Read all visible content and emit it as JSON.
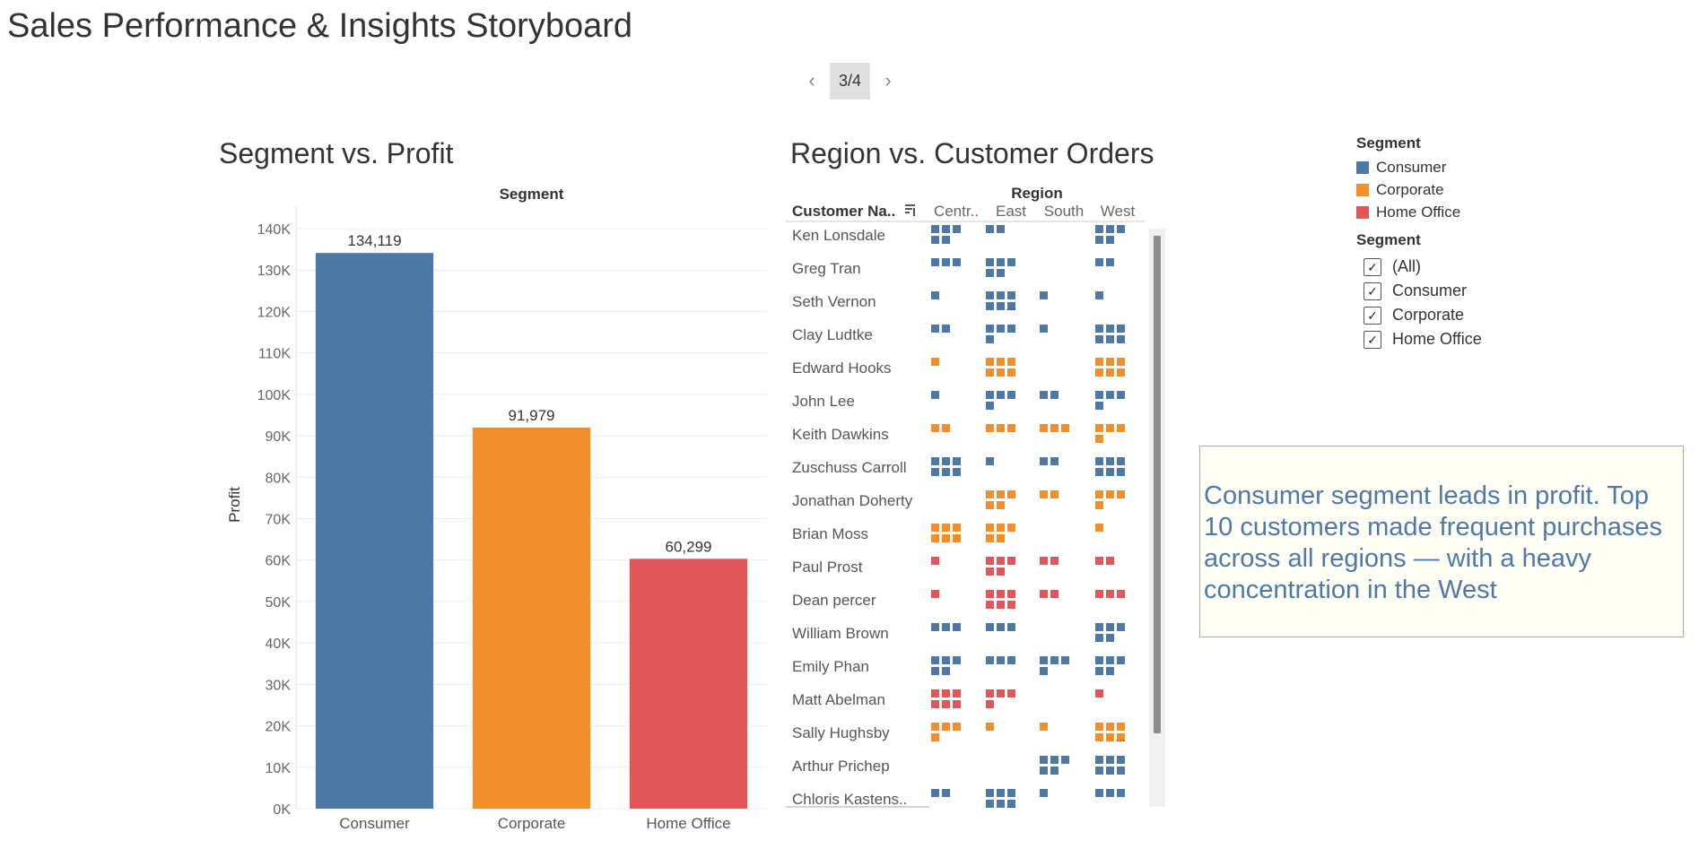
{
  "story": {
    "title": "Sales Performance & Insights Storyboard",
    "page_indicator": "3/4",
    "prev_icon": "‹",
    "next_icon": "›"
  },
  "colors": {
    "Consumer": "#4e79a7",
    "Corporate": "#f28e2b",
    "Home Office": "#e15759"
  },
  "chart_data": [
    {
      "type": "bar",
      "title": "Segment vs. Profit",
      "column_header": "Segment",
      "xlabel": "",
      "ylabel": "Profit",
      "categories": [
        "Consumer",
        "Corporate",
        "Home Office"
      ],
      "values": [
        134119,
        91979,
        60299
      ],
      "value_labels": [
        "134,119",
        "91,979",
        "60,299"
      ],
      "ylim": [
        0,
        140000
      ],
      "yticks": [
        0,
        10000,
        20000,
        30000,
        40000,
        50000,
        60000,
        70000,
        80000,
        90000,
        100000,
        110000,
        120000,
        130000,
        140000
      ],
      "ytick_labels": [
        "0K",
        "10K",
        "20K",
        "30K",
        "40K",
        "50K",
        "60K",
        "70K",
        "80K",
        "90K",
        "100K",
        "110K",
        "120K",
        "130K",
        "140K"
      ],
      "grid": true
    },
    {
      "type": "heatmap",
      "title": "Region vs. Customer Orders",
      "column_header": "Region",
      "row_header": "Customer Na..",
      "sort_icon": "sort-descending-icon",
      "columns": [
        "Centr..",
        "East",
        "South",
        "West"
      ],
      "rows": [
        {
          "name": "Ken Lonsdale",
          "segment": "Consumer",
          "orders": [
            5,
            2,
            0,
            5
          ]
        },
        {
          "name": "Greg Tran",
          "segment": "Consumer",
          "orders": [
            3,
            5,
            0,
            2
          ]
        },
        {
          "name": "Seth Vernon",
          "segment": "Consumer",
          "orders": [
            1,
            7,
            1,
            1
          ]
        },
        {
          "name": "Clay Ludtke",
          "segment": "Consumer",
          "orders": [
            2,
            4,
            1,
            6
          ]
        },
        {
          "name": "Edward Hooks",
          "segment": "Corporate",
          "orders": [
            1,
            6,
            0,
            6
          ]
        },
        {
          "name": "John Lee",
          "segment": "Consumer",
          "orders": [
            1,
            4,
            2,
            4
          ]
        },
        {
          "name": "Keith Dawkins",
          "segment": "Corporate",
          "orders": [
            2,
            3,
            3,
            4
          ]
        },
        {
          "name": "Zuschuss Carroll",
          "segment": "Consumer",
          "orders": [
            6,
            1,
            2,
            6
          ]
        },
        {
          "name": "Jonathan Doherty",
          "segment": "Corporate",
          "orders": [
            0,
            5,
            2,
            4
          ]
        },
        {
          "name": "Brian Moss",
          "segment": "Corporate",
          "orders": [
            6,
            5,
            0,
            1
          ]
        },
        {
          "name": "Paul Prost",
          "segment": "Home Office",
          "orders": [
            1,
            5,
            2,
            2
          ]
        },
        {
          "name": "Dean percer",
          "segment": "Home Office",
          "orders": [
            1,
            6,
            2,
            3
          ]
        },
        {
          "name": "William Brown",
          "segment": "Consumer",
          "orders": [
            3,
            3,
            0,
            5
          ]
        },
        {
          "name": "Emily Phan",
          "segment": "Consumer",
          "orders": [
            5,
            3,
            4,
            5
          ]
        },
        {
          "name": "Matt Abelman",
          "segment": "Home Office",
          "orders": [
            6,
            4,
            0,
            1
          ]
        },
        {
          "name": "Sally Hughsby",
          "segment": "Corporate",
          "orders": [
            4,
            1,
            1,
            7
          ]
        },
        {
          "name": "Arthur Prichep",
          "segment": "Consumer",
          "orders": [
            0,
            0,
            5,
            6
          ]
        },
        {
          "name": "Chloris Kastens..",
          "segment": "Consumer",
          "orders": [
            2,
            7,
            1,
            3
          ]
        }
      ]
    }
  ],
  "legend": {
    "title": "Segment",
    "items": [
      "Consumer",
      "Corporate",
      "Home Office"
    ]
  },
  "filter": {
    "title": "Segment",
    "items": [
      {
        "label": "(All)",
        "checked": true
      },
      {
        "label": "Consumer",
        "checked": true
      },
      {
        "label": "Corporate",
        "checked": true
      },
      {
        "label": "Home Office",
        "checked": true
      }
    ]
  },
  "annotation": {
    "text": "Consumer segment leads in profit. Top 10 customers made frequent purchases across all regions — with a heavy concentration in the West"
  }
}
